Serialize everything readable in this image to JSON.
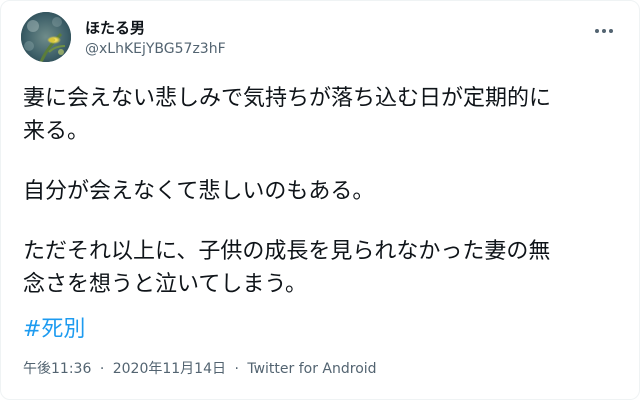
{
  "user": {
    "display_name": "ほたる男",
    "handle": "@xLhKEjYBG57z3hF",
    "avatar_icon": "firefly-avatar-icon"
  },
  "menu": {
    "icon": "more-options-icon"
  },
  "tweet": {
    "paragraphs": [
      "妻に会えない悲しみで気持ちが落ち込む日が定期的に\n来る。",
      "自分が会えなくて悲しいのもある。",
      "ただそれ以上に、子供の成長を見られなかった妻の無\n念さを想うと泣いてしまう。"
    ],
    "hashtag": "#死別"
  },
  "meta": {
    "time": "午後11:36",
    "separator": "·",
    "date": "2020年11月14日",
    "source": "Twitter for Android"
  },
  "colors": {
    "text": "#0f1419",
    "secondary": "#536471",
    "link": "#1d9bf0",
    "border": "#eff3f4"
  }
}
